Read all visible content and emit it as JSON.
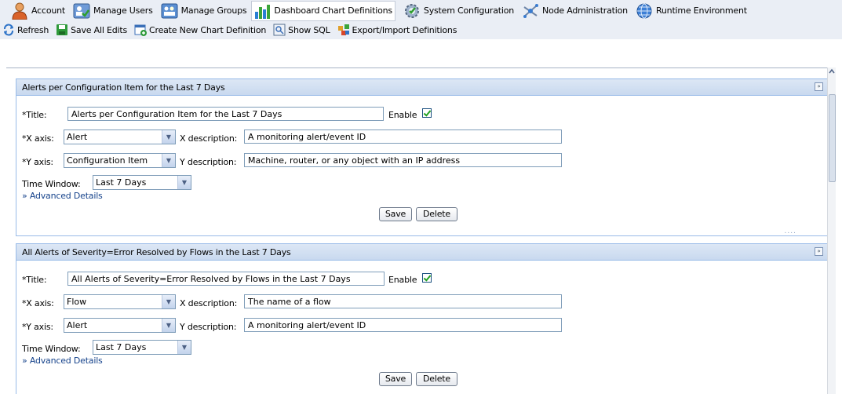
{
  "nav": {
    "items": [
      {
        "label": "Account",
        "icon": "account-icon"
      },
      {
        "label": "Manage Users",
        "icon": "users-icon"
      },
      {
        "label": "Manage Groups",
        "icon": "groups-icon"
      },
      {
        "label": "Dashboard Chart Definitions",
        "icon": "bar-chart-icon",
        "active": true
      },
      {
        "label": "System Configuration",
        "icon": "gear-icon"
      },
      {
        "label": "Node Administration",
        "icon": "network-icon"
      },
      {
        "label": "Runtime Environment",
        "icon": "globe-icon"
      }
    ]
  },
  "toolbar": {
    "refresh": "Refresh",
    "save_all": "Save All Edits",
    "create": "Create New Chart Definition",
    "show_sql": "Show SQL",
    "export_import": "Export/Import Definitions"
  },
  "panels": [
    {
      "header": "Alerts per Configuration Item for the Last 7 Days",
      "title_label": "*Title:",
      "title_value": "Alerts per Configuration Item for the Last 7 Days",
      "enable_label": "Enable",
      "enabled": true,
      "x_axis_label": "*X axis:",
      "x_axis_value": "Alert",
      "x_desc_label": "X description:",
      "x_desc_value": "A monitoring alert/event ID",
      "y_axis_label": "*Y axis:",
      "y_axis_value": "Configuration Item",
      "y_desc_label": "Y description:",
      "y_desc_value": "Machine, router, or any object with an IP address",
      "time_window_label": "Time Window:",
      "time_window_value": "Last 7 Days",
      "advanced": "» Advanced Details",
      "save": "Save",
      "delete": "Delete"
    },
    {
      "header": "All Alerts of Severity=Error Resolved by Flows in the Last 7 Days",
      "title_label": "*Title:",
      "title_value": "All Alerts of Severity=Error Resolved by Flows in the Last 7 Days",
      "enable_label": "Enable",
      "enabled": true,
      "x_axis_label": "*X axis:",
      "x_axis_value": "Flow",
      "x_desc_label": "X description:",
      "x_desc_value": "The name of a flow",
      "y_axis_label": "*Y axis:",
      "y_axis_value": "Alert",
      "y_desc_label": "Y description:",
      "y_desc_value": "A monitoring alert/event ID",
      "time_window_label": "Time Window:",
      "time_window_value": "Last 7 Days",
      "advanced": "» Advanced Details",
      "save": "Save",
      "delete": "Delete"
    }
  ],
  "colors": {
    "panel_border": "#99bbe8",
    "panel_header": "#d0def0",
    "link": "#15428b",
    "nav_bg": "#eaeef5",
    "checkmark": "#21a121"
  }
}
